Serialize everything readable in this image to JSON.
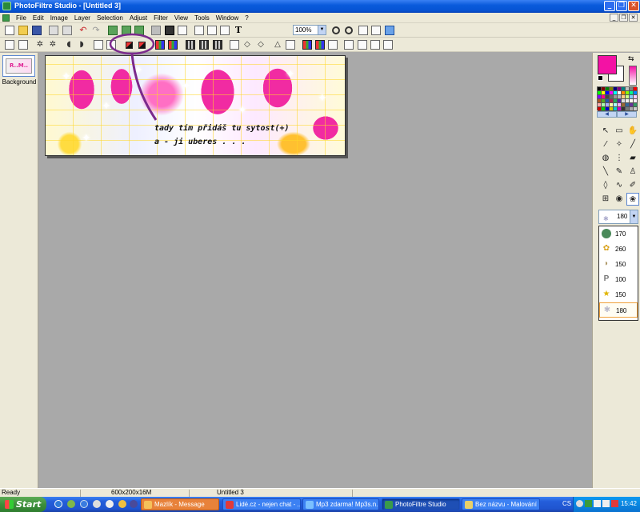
{
  "window": {
    "title": "PhotoFiltre Studio - [Untitled 3]",
    "buttons": [
      "_",
      "❐",
      "✕"
    ]
  },
  "menubar": {
    "items": [
      "File",
      "Edit",
      "Image",
      "Layer",
      "Selection",
      "Adjust",
      "Filter",
      "View",
      "Tools",
      "Window",
      "?"
    ]
  },
  "toolbar": {
    "zoom": "100%"
  },
  "layers": {
    "items": [
      {
        "label": "Background",
        "thumb_text": "R..M.."
      }
    ]
  },
  "canvas": {
    "annotation_line1": "tady tím přidáš tu sytost(+)",
    "annotation_line2": "a - ji uberes . . ."
  },
  "colors": {
    "foreground": "#f312a4",
    "background": "#ffffff",
    "annotation": "#7b2a8c"
  },
  "brush": {
    "selected_size": "180",
    "items": [
      {
        "icon": "green-globe-brush-icon",
        "size": "170"
      },
      {
        "icon": "flowers-brush-icon",
        "size": "260"
      },
      {
        "icon": "shell-brush-icon",
        "size": "150"
      },
      {
        "icon": "letter-p-brush-icon",
        "size": "100"
      },
      {
        "icon": "star-brush-icon",
        "size": "150"
      },
      {
        "icon": "sparkle-brush-icon",
        "size": "180"
      }
    ]
  },
  "status": {
    "state": "Ready",
    "size": "600x200x16M",
    "document": "Untitled 3"
  },
  "taskbar": {
    "start": "Start",
    "tasks": [
      {
        "label": "Mazlík - Message",
        "active": false
      },
      {
        "label": "Lidé.cz - nejen chat - ...",
        "active": false
      },
      {
        "label": "Mp3 zdarma! Mp3s.n...",
        "active": false
      },
      {
        "label": "PhotoFiltre Studio",
        "active": true
      },
      {
        "label": "Bez názvu - Malování",
        "active": false
      }
    ],
    "lang": "CS",
    "clock": "15:42"
  }
}
